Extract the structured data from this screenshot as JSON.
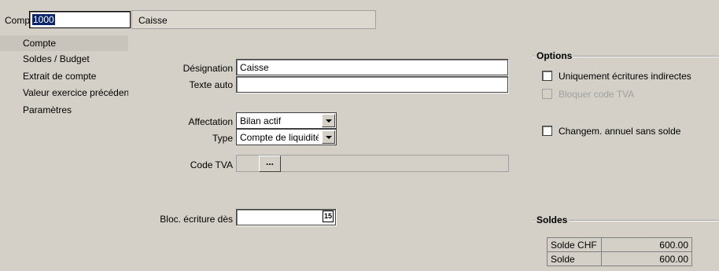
{
  "header": {
    "account_label": "Compte",
    "account_number": "1000",
    "account_name": "Caisse"
  },
  "nav": {
    "items": [
      {
        "label": "Compte",
        "active": true
      },
      {
        "label": "Soldes / Budget",
        "active": false
      },
      {
        "label": "Extrait de compte",
        "active": false
      },
      {
        "label": "Valeur exercice précédent",
        "active": false
      },
      {
        "label": "Paramètres",
        "active": false
      }
    ]
  },
  "form": {
    "designation_label": "Désignation",
    "designation_value": "Caisse",
    "texte_auto_label": "Texte auto",
    "texte_auto_value": "",
    "affectation_label": "Affectation",
    "affectation_value": "Bilan actif",
    "type_label": "Type",
    "type_value": "Compte de liquidités",
    "code_tva_label": "Code TVA",
    "code_tva_value": "",
    "code_tva_button": "...",
    "bloc_label": "Bloc. écriture dès",
    "bloc_value": "",
    "calendar_icon_text": "15"
  },
  "options": {
    "title": "Options",
    "items": [
      {
        "label": "Uniquement écritures indirectes",
        "checked": false,
        "enabled": true
      },
      {
        "label": "Bloquer code TVA",
        "checked": false,
        "enabled": false
      },
      {
        "label": "Changem. annuel sans solde",
        "checked": false,
        "enabled": true
      }
    ]
  },
  "soldes": {
    "title": "Soldes",
    "rows": [
      {
        "name": "Solde CHF",
        "value": "600.00"
      },
      {
        "name": "Solde",
        "value": "600.00"
      }
    ]
  },
  "icons": {
    "dropdown": "chevron-down-icon",
    "calendar": "calendar-icon",
    "ellipsis": "ellipsis-icon"
  }
}
